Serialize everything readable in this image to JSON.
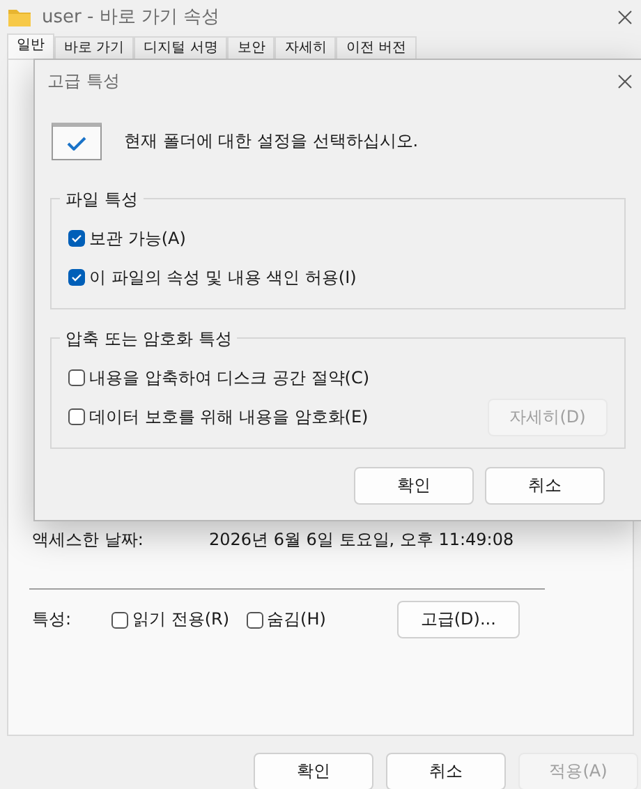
{
  "window": {
    "title": "user - 바로 가기 속성"
  },
  "tabs": [
    {
      "label": "일반",
      "selected": true
    },
    {
      "label": "바로 가기",
      "selected": false
    },
    {
      "label": "디지털 서명",
      "selected": false
    },
    {
      "label": "보안",
      "selected": false
    },
    {
      "label": "자세히",
      "selected": false
    },
    {
      "label": "이전 버전",
      "selected": false
    }
  ],
  "panel": {
    "rows": [
      {
        "label": "액세스한 날짜:",
        "value": "2026년 6월 6일 토요일, 오후 11:49:08"
      }
    ],
    "attributes_label": "특성:",
    "attributes": [
      {
        "label": "읽기 전용(R)",
        "checked": false
      },
      {
        "label": "숨김(H)",
        "checked": false
      }
    ],
    "advanced_button": "고급(D)..."
  },
  "buttons": [
    {
      "label": "확인",
      "disabled": false
    },
    {
      "label": "취소",
      "disabled": false
    },
    {
      "label": "적용(A)",
      "disabled": true
    }
  ],
  "dialog": {
    "title": "고급 특성",
    "prompt": "현재 폴더에 대한 설정을 선택하십시오.",
    "groups": [
      {
        "title": "파일 특성",
        "options": [
          {
            "label": "보관 가능(A)",
            "checked": true
          },
          {
            "label": "이 파일의 속성 및 내용 색인 허용(I)",
            "checked": true
          }
        ]
      },
      {
        "title": "압축 또는 암호화 특성",
        "options": [
          {
            "label": "내용을 압축하여 디스크 공간 절약(C)",
            "checked": false
          },
          {
            "label": "데이터 보호를 위해 내용을 암호화(E)",
            "checked": false
          }
        ],
        "details_button": {
          "label": "자세히(D)",
          "disabled": true
        }
      }
    ],
    "buttons": [
      {
        "label": "확인",
        "disabled": false
      },
      {
        "label": "취소",
        "disabled": false
      }
    ]
  }
}
